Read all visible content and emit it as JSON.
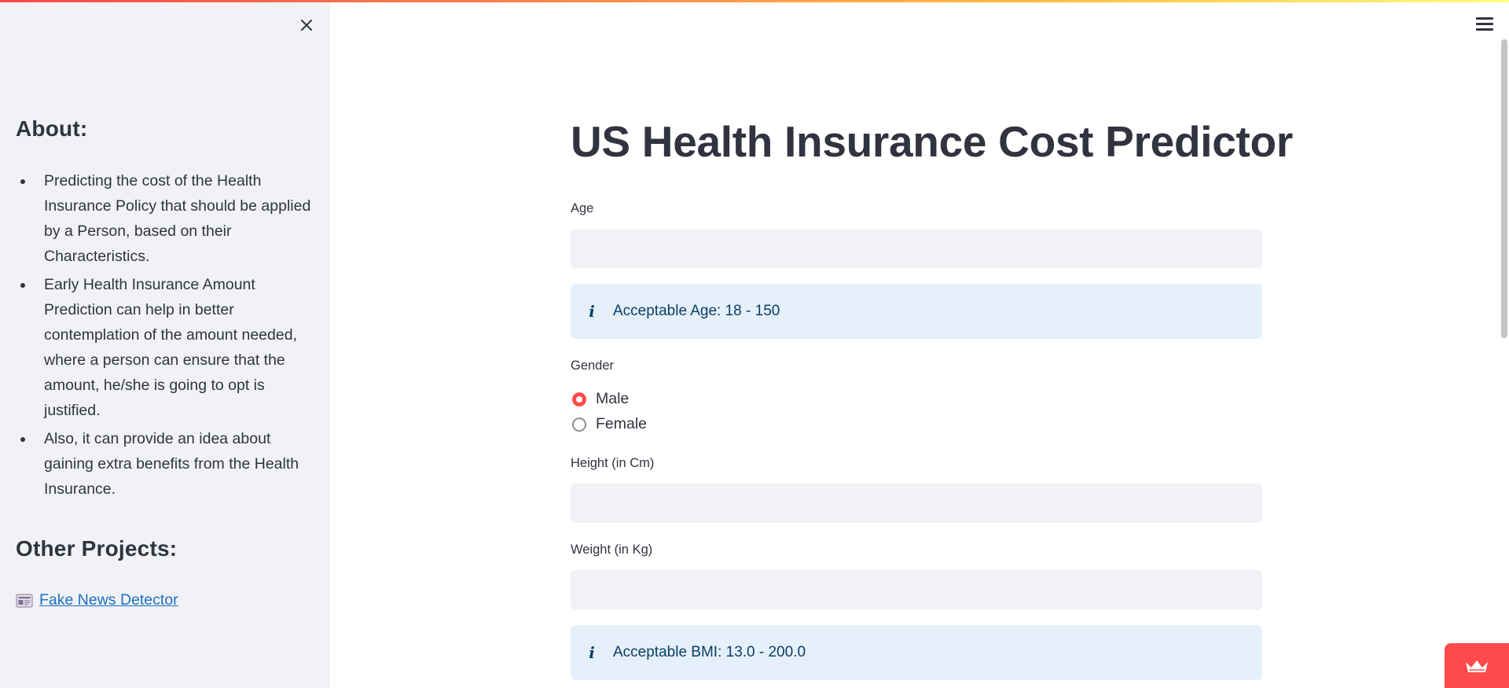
{
  "sidebar": {
    "about_heading": "About:",
    "about_items": [
      "Predicting the cost of the Health Insurance Policy that should be applied by a Person, based on their Characteristics.",
      "Early Health Insurance Amount Prediction can help in better contemplation of the amount needed, where a person can ensure that the amount, he/she is going to opt is justified.",
      "Also, it can provide an idea about gaining extra benefits from the Health Insurance."
    ],
    "projects_heading": "Other Projects:",
    "project_link": "Fake News Detector"
  },
  "main": {
    "title": "US Health Insurance Cost Predictor",
    "age": {
      "label": "Age",
      "value": "",
      "info": "Acceptable Age: 18 - 150"
    },
    "gender": {
      "label": "Gender",
      "options": [
        "Male",
        "Female"
      ],
      "selected": "Male"
    },
    "height": {
      "label": "Height (in Cm)",
      "value": ""
    },
    "weight": {
      "label": "Weight (in Kg)",
      "value": ""
    },
    "bmi_info": "Acceptable BMI: 13.0 - 200.0"
  },
  "colors": {
    "accent": "#ff4b4b",
    "sidebar_bg": "#f0f2f6",
    "info_bg": "#e5f0fb",
    "info_text": "#0c3e63",
    "link": "#1c6fc2"
  },
  "icons": {
    "sidebar_close": "close-icon",
    "menu": "hamburger-menu-icon",
    "info": "info-icon",
    "project": "newspaper-icon",
    "badge": "streamlit-crown-icon"
  }
}
